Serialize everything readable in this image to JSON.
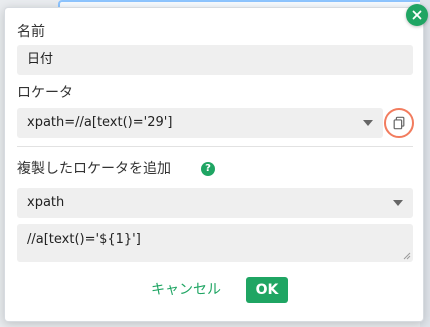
{
  "dialog": {
    "name_label": "名前",
    "name_value": "日付",
    "locator_label": "ロケータ",
    "locator_value": "xpath=//a[text()='29']",
    "duplicate_label": "複製したロケータを追加",
    "help_symbol": "?",
    "locator_type_value": "xpath",
    "locator_expression": "//a[text()='${1}']",
    "cancel_label": "キャンセル",
    "ok_label": "OK"
  },
  "icons": {
    "close": "close-icon",
    "copy": "copy-icon",
    "help": "help-icon",
    "dropdown": "chevron-down-icon"
  },
  "colors": {
    "accent": "#1fa563",
    "highlight_ring": "#f27c5e",
    "field_background": "#efefef"
  }
}
